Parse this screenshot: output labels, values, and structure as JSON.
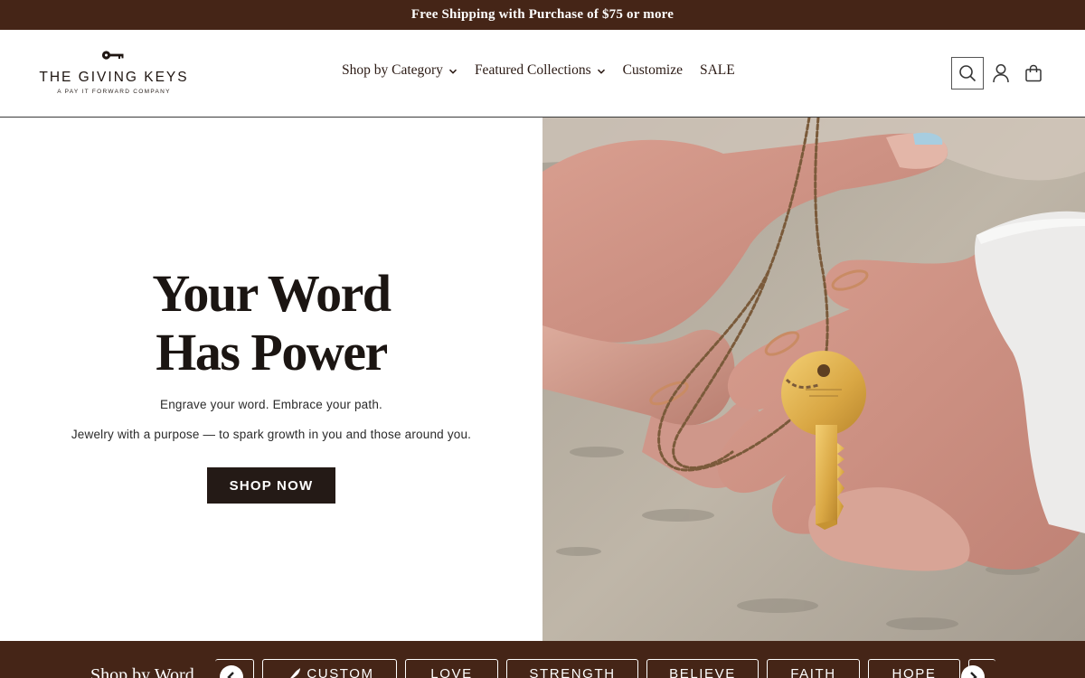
{
  "announcement": "Free Shipping with Purchase of $75 or more",
  "logo": {
    "wordmark": "THE GIVING KEYS",
    "tagline": "A PAY IT FORWARD COMPANY"
  },
  "nav": {
    "shop_by_category": "Shop by Category",
    "featured_collections": "Featured Collections",
    "customize": "Customize",
    "sale": "SALE"
  },
  "hero": {
    "title_line1": "Your Word",
    "title_line2": "Has Power",
    "subtitle1": "Engrave your word. Embrace your path.",
    "subtitle2": "Jewelry with a purpose — to spark growth in you and those around you.",
    "cta": "SHOP NOW"
  },
  "shop_by_word": {
    "title": "Shop by Word",
    "words": [
      "CUSTOM",
      "LOVE",
      "STRENGTH",
      "BELIEVE",
      "FAITH",
      "HOPE"
    ]
  },
  "colors": {
    "brand_brown": "#452517",
    "button_dark": "#241a16"
  },
  "icons": [
    "key-logo-icon",
    "chevron-down-icon",
    "search-icon",
    "account-icon",
    "cart-icon",
    "feather-icon",
    "arrow-left-icon",
    "arrow-right-icon"
  ]
}
